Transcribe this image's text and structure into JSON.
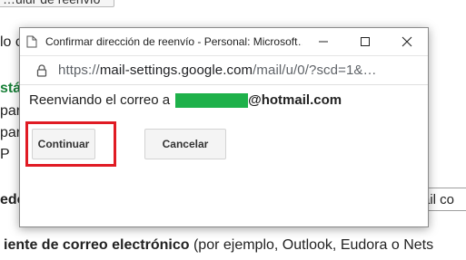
{
  "background": {
    "top_button_label": "…ulur de reenvío",
    "left_fragment_1": "lo c",
    "left_fragment_green": "stá",
    "left_fragment_2": "par",
    "left_fragment_3": "par",
    "left_fragment_4": "P",
    "left_fragment_5": "edo",
    "right_input_value": "ail co",
    "bottom_bold": "iente de correo electrónico",
    "bottom_rest": " (por ejemplo, Outlook, Eudora o Nets"
  },
  "popup": {
    "title": "Confirmar dirección de reenvío - Personal: Microsoft…",
    "url_prefix": "https://",
    "url_host": "mail-settings.google.com",
    "url_path": "/mail/u/0/?scd=1&…",
    "message_prefix": "Reenviando el correo a",
    "email_suffix": "@hotmail.com",
    "continue_label": "Continuar",
    "cancel_label": "Cancelar"
  },
  "colors": {
    "highlight": "#e01b24",
    "redaction": "#1eb14a",
    "green_text": "#188038"
  },
  "icons": [
    "page-icon",
    "minimize-icon",
    "maximize-icon",
    "close-icon",
    "lock-icon"
  ]
}
